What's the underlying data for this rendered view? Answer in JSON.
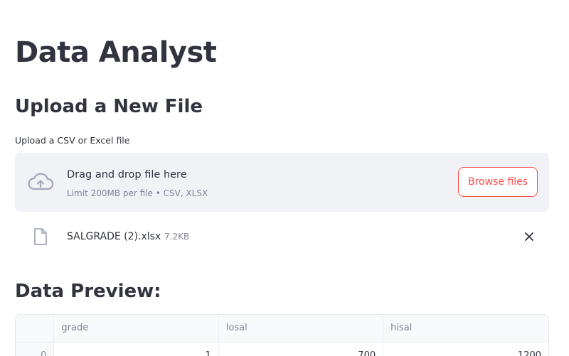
{
  "page": {
    "title": "Data Analyst"
  },
  "upload_section": {
    "heading": "Upload a New File",
    "label": "Upload a CSV or Excel file",
    "dropzone": {
      "main_text": "Drag and drop file here",
      "limit_text": "Limit 200MB per file • CSV, XLSX",
      "icon": "cloud-upload-icon",
      "browse_label": "Browse files"
    },
    "uploaded_file": {
      "icon": "file-icon",
      "name": "SALGRADE (2).xlsx",
      "size": "7.2KB",
      "remove_icon": "close-icon"
    }
  },
  "preview_section": {
    "heading": "Data Preview:",
    "columns": [
      "",
      "grade",
      "losal",
      "hisal"
    ],
    "rows": [
      {
        "index": "0",
        "grade": "1",
        "losal": "700",
        "hisal": "1200"
      }
    ]
  },
  "colors": {
    "accent": "#ff4b4b",
    "text": "#31333f",
    "muted": "#808495",
    "dropzone_bg": "#f0f2f6"
  }
}
